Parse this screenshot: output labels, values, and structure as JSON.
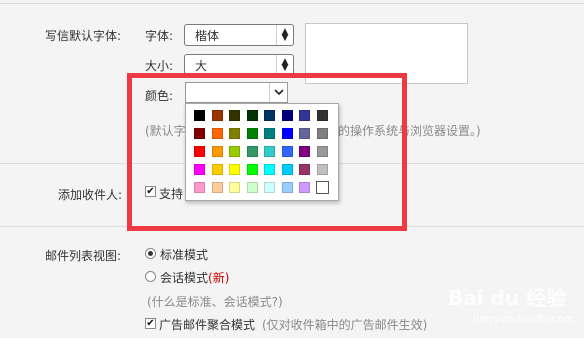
{
  "font_settings": {
    "section_label": "写信默认字体:",
    "font_label": "字体:",
    "font_value": "楷体",
    "size_label": "大小:",
    "size_value": "大",
    "color_label": "颜色:",
    "color_value": "",
    "hint_left": "(默认字",
    "hint_right": "的操作系统与浏览器设置。)"
  },
  "palette": {
    "rows": [
      [
        "#000000",
        "#993300",
        "#333300",
        "#003300",
        "#003366",
        "#000080",
        "#333399",
        "#333333"
      ],
      [
        "#800000",
        "#ff6600",
        "#808000",
        "#008000",
        "#008080",
        "#0000ff",
        "#666699",
        "#808080"
      ],
      [
        "#ff0000",
        "#ff9900",
        "#99cc00",
        "#339966",
        "#33cccc",
        "#3366ff",
        "#800080",
        "#999999"
      ],
      [
        "#ff00ff",
        "#ffcc00",
        "#ffff00",
        "#00ff00",
        "#00ffff",
        "#00ccff",
        "#993366",
        "#c0c0c0"
      ],
      [
        "#ff99cc",
        "#ffcc99",
        "#ffff99",
        "#ccffcc",
        "#ccffff",
        "#99ccff",
        "#cc99ff",
        "#ffffff"
      ]
    ],
    "selected": "#ffffff"
  },
  "recipients": {
    "label": "添加收件人:",
    "checkbox_text": "支持"
  },
  "mail_list": {
    "label": "邮件列表视图:",
    "option_standard": "标准模式",
    "option_conversation": "会话模式",
    "new_badge": "(新)",
    "help_link": "(什么是标准、会话模式?)",
    "ad_checkbox": "广告邮件聚合模式",
    "ad_note": "(仅对收件箱中的广告邮件生效)"
  },
  "watermark": {
    "brand": "Bai du 经验",
    "url": "jingyan.baidu.com"
  },
  "colors": {
    "highlight": "#ee3b41",
    "new_badge": "#cc0000"
  }
}
